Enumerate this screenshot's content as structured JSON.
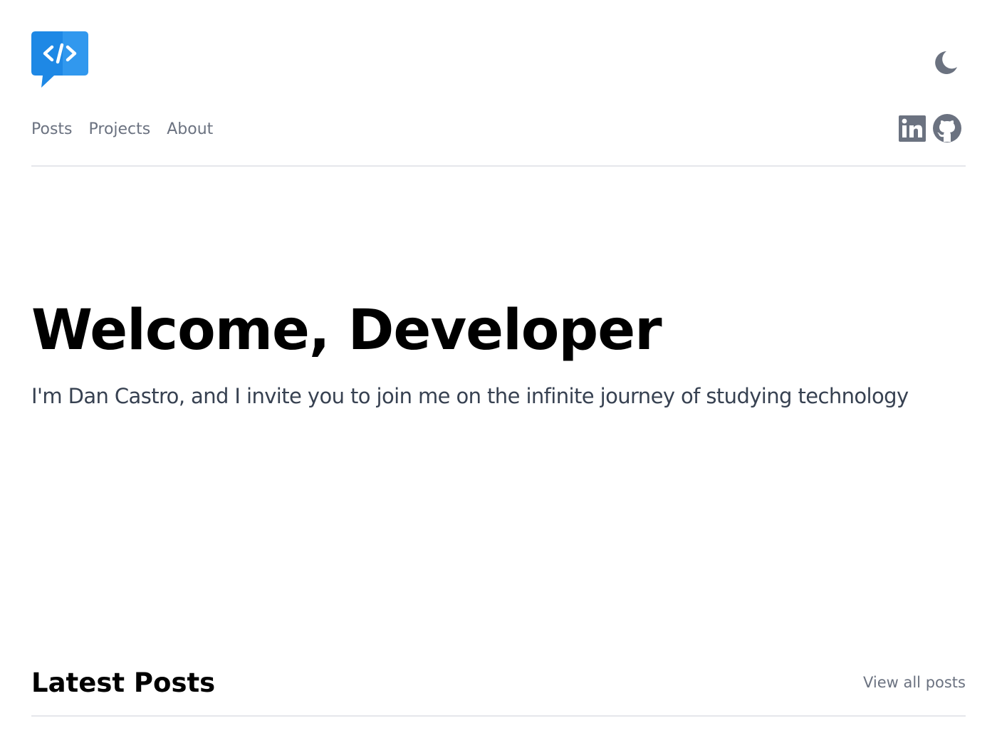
{
  "colors": {
    "brand_blue": "#1e88e5",
    "brand_blue_light": "#42a5f5",
    "icon_gray": "#6b7280",
    "text_dark": "#374151",
    "heading": "#000000",
    "divider": "#e5e7eb"
  },
  "header": {
    "logo_icon": "code-chat-bubble-logo",
    "theme_toggle_icon": "moon-icon",
    "nav": [
      {
        "label": "Posts"
      },
      {
        "label": "Projects"
      },
      {
        "label": "About"
      }
    ],
    "social": [
      {
        "icon": "linkedin-icon"
      },
      {
        "icon": "github-icon"
      }
    ]
  },
  "hero": {
    "title": "Welcome, Developer",
    "subtitle": "I'm Dan Castro, and I invite you to join me on the infinite journey of studying technology"
  },
  "latest_posts": {
    "title": "Latest Posts",
    "view_all": "View all posts"
  }
}
